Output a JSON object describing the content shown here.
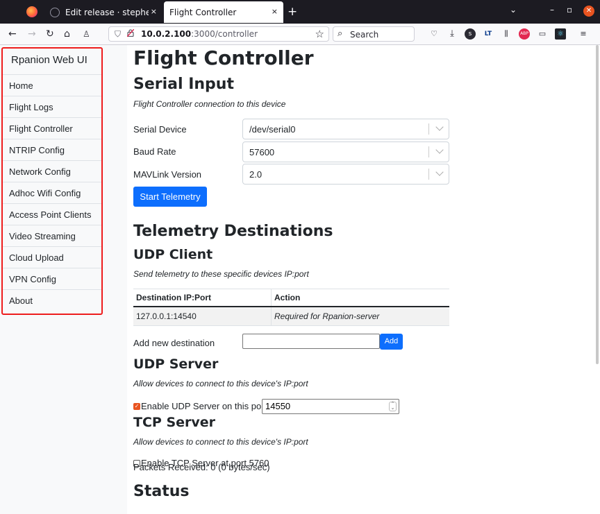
{
  "browser": {
    "tabs": [
      {
        "title": "Edit release · stephendade",
        "active": false
      },
      {
        "title": "Flight Controller",
        "active": true
      }
    ],
    "tab_close": "×",
    "new_tab": "+",
    "url_host": "10.0.2.100",
    "url_rest": ":3000/controller",
    "search_placeholder": "Search",
    "win_controls": [
      "⌄",
      "–",
      "▫",
      "✕"
    ]
  },
  "sidebar": {
    "brand": "Rpanion Web UI",
    "items": [
      {
        "label": "Home"
      },
      {
        "label": "Flight Logs"
      },
      {
        "label": "Flight Controller"
      },
      {
        "label": "NTRIP Config"
      },
      {
        "label": "Network Config"
      },
      {
        "label": "Adhoc Wifi Config"
      },
      {
        "label": "Access Point Clients"
      },
      {
        "label": "Video Streaming"
      },
      {
        "label": "Cloud Upload"
      },
      {
        "label": "VPN Config"
      },
      {
        "label": "About"
      }
    ]
  },
  "main": {
    "title": "Flight Controller",
    "serial": {
      "heading": "Serial Input",
      "subtitle": "Flight Controller connection to this device",
      "device_label": "Serial Device",
      "device_value": "/dev/serial0",
      "baud_label": "Baud Rate",
      "baud_value": "57600",
      "mavlink_label": "MAVLink Version",
      "mavlink_value": "2.0",
      "start_button": "Start Telemetry"
    },
    "telemetry": {
      "heading": "Telemetry Destinations",
      "udp_client_heading": "UDP Client",
      "udp_client_subtitle": "Send telemetry to these specific devices IP:port",
      "table_headers": [
        "Destination IP:Port",
        "Action"
      ],
      "table_rows": [
        {
          "dest": "127.0.0.1:14540",
          "action": "Required for Rpanion-server"
        }
      ],
      "add_label": "Add new destination",
      "add_value": "",
      "add_button": "Add",
      "udp_server_heading": "UDP Server",
      "udp_server_subtitle": "Allow devices to connect to this device's IP:port",
      "udp_server_checkbox": "Enable UDP Server on this port:",
      "udp_server_checked": true,
      "udp_server_port": "14550",
      "tcp_server_heading": "TCP Server",
      "tcp_server_subtitle": "Allow devices to connect to this device's IP:port",
      "tcp_server_checkbox": "Enable TCP Server at port 5760",
      "tcp_server_checked": false
    },
    "status": {
      "heading": "Status",
      "packets_partial": "Packets Received: 0 (0 bytes/sec)"
    }
  },
  "colors": {
    "primary": "#0d6efd",
    "highlight_border": "#ee1c1c",
    "checkbox_accent": "#e95420",
    "tabbar_bg": "#1c1b22"
  }
}
